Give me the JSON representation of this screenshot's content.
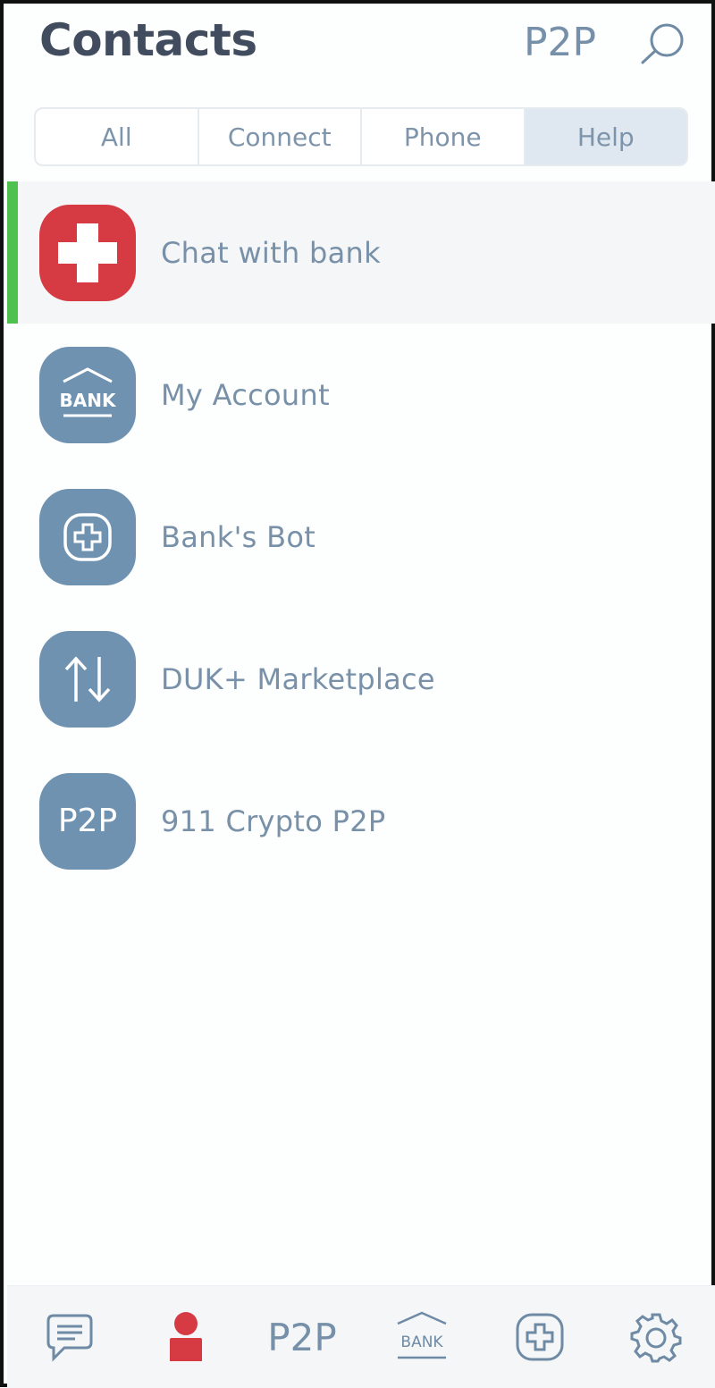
{
  "header": {
    "title": "Contacts",
    "p2p_label": "P2P",
    "search_icon": "search-icon"
  },
  "tabs": [
    {
      "label": "All",
      "active": false
    },
    {
      "label": "Connect",
      "active": false
    },
    {
      "label": "Phone",
      "active": false
    },
    {
      "label": "Help",
      "active": true
    }
  ],
  "contacts": [
    {
      "label": "Chat with bank",
      "icon": "medical-cross-icon",
      "selected": true
    },
    {
      "label": "My Account",
      "icon": "bank-icon",
      "selected": false
    },
    {
      "label": "Bank's Bot",
      "icon": "plus-badge-icon",
      "selected": false
    },
    {
      "label": "DUK+ Marketplace",
      "icon": "transfer-arrows-icon",
      "selected": false
    },
    {
      "label": "911 Crypto P2P",
      "icon": "p2p-icon",
      "avatar_text": "P2P",
      "selected": false
    }
  ],
  "bottom_nav": {
    "items": [
      {
        "name": "chat",
        "icon": "chat-bubble-icon"
      },
      {
        "name": "contacts",
        "icon": "person-icon",
        "active": true
      },
      {
        "name": "p2p",
        "label": "P2P"
      },
      {
        "name": "bank",
        "icon": "bank-icon",
        "label": "BANK"
      },
      {
        "name": "help",
        "icon": "plus-badge-icon"
      },
      {
        "name": "settings",
        "icon": "gear-icon"
      }
    ]
  },
  "icon_labels": {
    "bank": "BANK"
  },
  "colors": {
    "accent_red": "#d63b44",
    "avatar_blue": "#6f92b1",
    "selected_green": "#4ec14e",
    "text_blue_gray": "#7890a8",
    "title": "#414d5f"
  }
}
